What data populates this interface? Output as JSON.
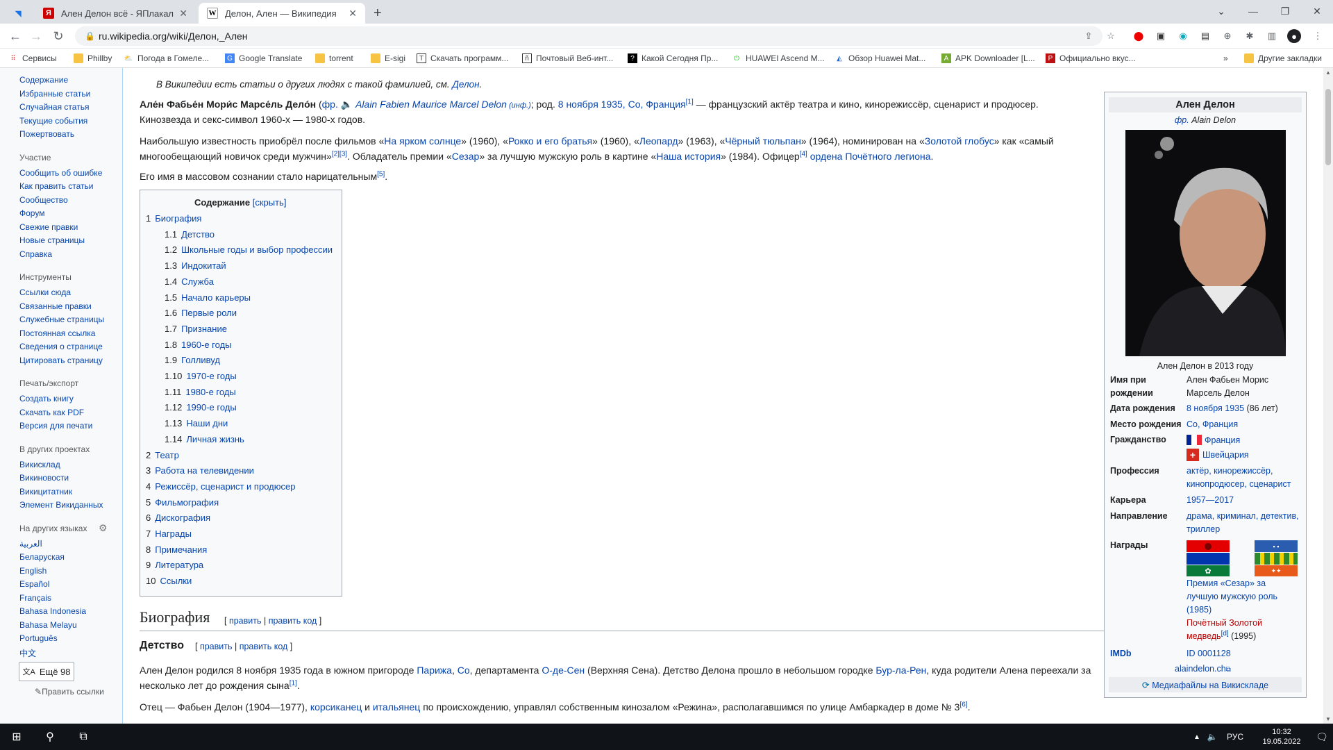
{
  "browser": {
    "tabs": [
      {
        "title": "Ален Делон всё - ЯПлакалъ",
        "icon": "yaplakal-icon"
      },
      {
        "title": "Делон, Ален — Википедия",
        "icon": "wikipedia-icon"
      }
    ],
    "new_tab": "+",
    "url": "ru.wikipedia.org/wiki/Делон,_Ален",
    "bookmarks": [
      "Сервисы",
      "Phillby",
      "Погода в Гомеле...",
      "Google Translate",
      "torrent",
      "E-sigi",
      "Скачать программ...",
      "Почтовый Веб-инт...",
      "Какой Сегодня Пр...",
      "HUAWEI Ascend M...",
      "Обзор Huawei Mat...",
      "APK Downloader [L...",
      "Официально вкус..."
    ],
    "other_bookmarks": "Другие закладки",
    "more_bookmarks": "»"
  },
  "sidebar": {
    "nav": [
      "Содержание",
      "Избранные статьи",
      "Случайная статья",
      "Текущие события",
      "Пожертвовать"
    ],
    "part_head": "Участие",
    "part": [
      "Сообщить об ошибке",
      "Как править статьи",
      "Сообщество",
      "Форум",
      "Свежие правки",
      "Новые страницы",
      "Справка"
    ],
    "tools_head": "Инструменты",
    "tools": [
      "Ссылки сюда",
      "Связанные правки",
      "Служебные страницы",
      "Постоянная ссылка",
      "Сведения о странице",
      "Цитировать страницу"
    ],
    "print_head": "Печать/экспорт",
    "print": [
      "Создать книгу",
      "Скачать как PDF",
      "Версия для печати"
    ],
    "proj_head": "В других проектах",
    "proj": [
      "Викисклад",
      "Викиновости",
      "Викицитатник",
      "Элемент Викиданных"
    ],
    "lang_head": "На других языках",
    "langs": [
      "العربية",
      "Беларуская",
      "English",
      "Español",
      "Français",
      "Bahasa Indonesia",
      "Bahasa Melayu",
      "Português",
      "中文"
    ],
    "more_langs": "Ещё 98",
    "edit_links": "Править ссылки"
  },
  "article": {
    "hatnote_a": "В Википедии есть статьи о других людях с такой фамилией, см. ",
    "hatnote_link": "Делон",
    "hatnote_end": ".",
    "p1_name": "Але́н Фабье́н Мори́с Марсе́ль Делóн",
    "p1_a": " (",
    "p1_fr": "фр.",
    "p1_listen": " 🔈 ",
    "p1_orig": "Alain Fabien Maurice Marcel Delon",
    "p1_inf": " (инф.)",
    "p1_b": "; род. ",
    "p1_date": "8 ноября 1935, Со, Франция",
    "p1_ref": "[1]",
    "p1_c": " — французский актёр театра и кино, кинорежиссёр, сценарист и продюсер.",
    "p1_line2": "Кинозвезда и секс-символ 1960-х — 1980-х годов.",
    "p2_a": "Наибольшую известность приобрёл после фильмов «",
    "p2_f1": "На ярком солнце",
    "p2_b": "» (1960), «",
    "p2_f2": "Рокко и его братья",
    "p2_c": "» (1960), «",
    "p2_f3": "Леопард",
    "p2_d": "» (1963), «",
    "p2_f4": "Чёрный тюльпан",
    "p2_e": "» (1964), номинирован на «",
    "p2_f5": "Золотой глобус",
    "p2_f": "» как «самый",
    "p2_l2a": "многообещающий новичок среди мужчин»",
    "p2_ref1": "[2][3]",
    "p2_l2b": ". Обладатель премии «",
    "p2_f6": "Сезар",
    "p2_l2c": "» за лучшую мужскую роль в картине «",
    "p2_f7": "Наша история",
    "p2_l2d": "» (1984). Офицер",
    "p2_ref2": "[4]",
    "p2_l2e": " ",
    "p2_f8": "ордена Почётного легиона",
    "p2_l2f": ".",
    "p3": "Его имя в массовом сознании стало нарицательным",
    "p3_ref": "[5]",
    "p3_end": ".",
    "toc_title": "Содержание",
    "toc_hide": "[скрыть]",
    "toc": [
      {
        "n": "1",
        "t": "Биография"
      },
      {
        "n": "1.1",
        "t": "Детство"
      },
      {
        "n": "1.2",
        "t": "Школьные годы и выбор профессии"
      },
      {
        "n": "1.3",
        "t": "Индокитай"
      },
      {
        "n": "1.4",
        "t": "Служба"
      },
      {
        "n": "1.5",
        "t": "Начало карьеры"
      },
      {
        "n": "1.6",
        "t": "Первые роли"
      },
      {
        "n": "1.7",
        "t": "Признание"
      },
      {
        "n": "1.8",
        "t": "1960-е годы"
      },
      {
        "n": "1.9",
        "t": "Голливуд"
      },
      {
        "n": "1.10",
        "t": "1970-е годы"
      },
      {
        "n": "1.11",
        "t": "1980-е годы"
      },
      {
        "n": "1.12",
        "t": "1990-е годы"
      },
      {
        "n": "1.13",
        "t": "Наши дни"
      },
      {
        "n": "1.14",
        "t": "Личная жизнь"
      },
      {
        "n": "2",
        "t": "Театр"
      },
      {
        "n": "3",
        "t": "Работа на телевидении"
      },
      {
        "n": "4",
        "t": "Режиссёр, сценарист и продюсер"
      },
      {
        "n": "5",
        "t": "Фильмография"
      },
      {
        "n": "6",
        "t": "Дискография"
      },
      {
        "n": "7",
        "t": "Награды"
      },
      {
        "n": "8",
        "t": "Примечания"
      },
      {
        "n": "9",
        "t": "Литература"
      },
      {
        "n": "10",
        "t": "Ссылки"
      }
    ],
    "h2": "Биография",
    "edit_open": "[ ",
    "edit": "править",
    "sep": " | ",
    "edit_code": "править код",
    "edit_close": " ]",
    "h3": "Детство",
    "b1_a": "Ален Делон родился 8 ноября 1935 года в южном пригороде ",
    "b1_l1": "Парижа",
    "b1_b": ", ",
    "b1_l2": "Со",
    "b1_c": ", департамента ",
    "b1_l3": "О-де-Сен",
    "b1_d": " (Верхняя Сена). Детство Делона прошло в небольшом городке ",
    "b1_l4": "Бур-ла-Рен",
    "b1_e": ", куда родители Алена переехали за",
    "b1_line2": "несколько лет до рождения сына",
    "b1_ref": "[1]",
    "b1_end": ".",
    "b2_a": "Отец — Фабьен Делон (1904—1977), ",
    "b2_l1": "корсиканец",
    "b2_b": " и ",
    "b2_l2": "итальянец",
    "b2_c": " по происхождению, управлял собственным кинозалом «Режина», располагавшимся по улице Амбаркадер в доме № 3",
    "b2_ref": "[6]",
    "b2_end": "."
  },
  "infobox": {
    "title": "Ален Делон",
    "fr": "фр.",
    "orig": "Alain Delon",
    "caption": "Ален Делон в 2013 году",
    "birthname_l1": "Имя при",
    "birthname_l2": "рождении",
    "birthname_v1": "Ален Фабьен Морис",
    "birthname_v2": "Марсель Делон",
    "bdate_l": "Дата рождения",
    "bdate_v": "8 ноября 1935",
    "bdate_age": " (86 лет)",
    "bplace_l": "Место рождения",
    "bplace_v": "Со, Франция",
    "cit_l": "Гражданство",
    "cit_1": "Франция",
    "cit_2": "Швейцария",
    "prof_l": "Профессия",
    "prof_1": "актёр, кинорежиссёр,",
    "prof_2": "кинопродюсер, сценарист",
    "career_l": "Карьера",
    "career_v": "1957—2017",
    "dir_l": "Направление",
    "dir_1": "драма, криминал, детектив,",
    "dir_2": "триллер",
    "awards_l": "Награды",
    "aw_1": "Премия «Сезар» за",
    "aw_2": "лучшую мужскую роль",
    "aw_3": "(1985)",
    "aw_4": "Почётный Золотой",
    "aw_5": "медведь",
    "aw_ref": "[d]",
    "aw_6": " (1995)",
    "imdb_l": "IMDb",
    "imdb_v": "ID 0001128",
    "site": "alaindelon.ch",
    "commons": "Медиафайлы на Викискладе"
  },
  "taskbar": {
    "lang": "РУС",
    "time": "10:32",
    "date": "19.05.2022"
  },
  "colors": {
    "link": "#0645ad",
    "redlink": "#ba0000",
    "taskbar": "#101318"
  }
}
